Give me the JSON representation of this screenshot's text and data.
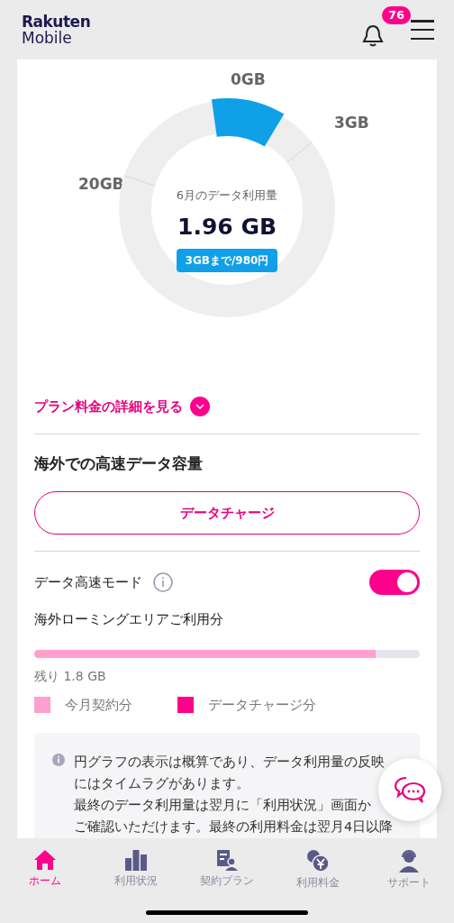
{
  "header": {
    "logo_top": "Rakuten",
    "logo_bottom": "Mobile",
    "notification_count": "76"
  },
  "usage": {
    "labels": [
      {
        "text": "0GB",
        "kind": "top"
      },
      {
        "text": "3GB",
        "kind": "right"
      },
      {
        "text": "20GB",
        "kind": "left"
      }
    ],
    "caption": "6月のデータ利用量",
    "amount": "1.96 GB",
    "level": 0.65,
    "plan_badge": "3GBまで/980円"
  },
  "plan_details_link": {
    "label": "プラン料金の詳細を見る",
    "expanded": false
  },
  "overseas": {
    "title": "海外での高速データ容量",
    "charge_button": "データチャージ",
    "high_speed_mode": {
      "label": "データ高速モード",
      "on": true
    },
    "roaming_label": "海外ローミングエリアご利用分",
    "level": 0.885,
    "remaining": "残り 1.8 GB",
    "legend": [
      {
        "label": "今月契約分",
        "color": "#ff9fd0"
      },
      {
        "label": "データチャージ分",
        "color": "#ff0088"
      }
    ]
  },
  "note": {
    "lines": [
      "円グラフの表示は概算であり、データ利用量の反映",
      "にはタイムラグがあります。",
      "最終のデータ利用量は翌月に「利用状況」画面か",
      "ご確認いただけます。最終の利用料金は翌月4日以降"
    ]
  },
  "tab_bar": [
    {
      "label": "ホーム",
      "kind": "home",
      "selected": true
    },
    {
      "label": "利用状況",
      "kind": "usage",
      "selected": false
    },
    {
      "label": "契約プラン",
      "kind": "plan",
      "selected": false
    },
    {
      "label": "利用料金",
      "kind": "fee",
      "selected": false
    },
    {
      "label": "サポート",
      "kind": "support",
      "selected": false
    }
  ]
}
